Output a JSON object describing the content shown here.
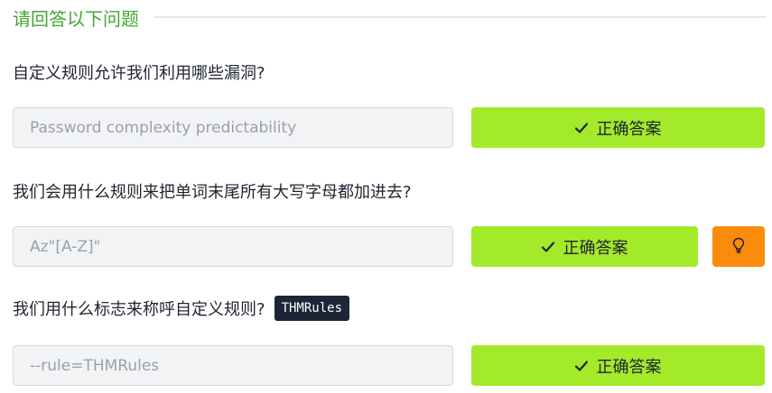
{
  "header": {
    "title": "请回答以下问题"
  },
  "questions": [
    {
      "text": "自定义规则允许我们利用哪些漏洞?",
      "answer": "Password complexity predictability",
      "button_label": "正确答案"
    },
    {
      "text": "我们会用什么规则来把单词末尾所有大写字母都加进去?",
      "answer": "Az\"[A-Z]\"",
      "button_label": "正确答案",
      "hint_icon": "lightbulb-icon"
    },
    {
      "text": "我们用什么标志来称呼自定义规则?",
      "code_tag": "THMRules",
      "answer": "--rule=THMRules",
      "button_label": "正确答案"
    }
  ],
  "icons": {
    "correct": "check-icon",
    "hint": "lightbulb-icon"
  },
  "colors": {
    "accent_green_text": "#45a533",
    "correct_button": "#a3ea2a",
    "hint_button": "#fb8b0a",
    "code_tag_bg": "#1d2537"
  }
}
